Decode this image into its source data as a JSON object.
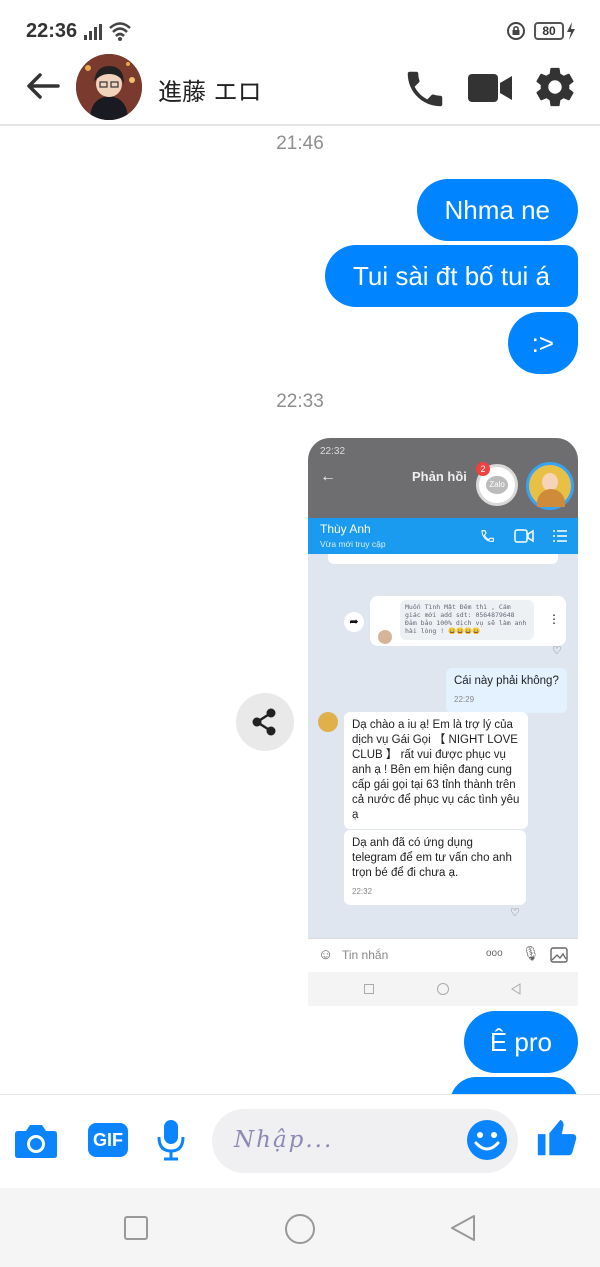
{
  "status_bar": {
    "time": "22:36",
    "battery": "80"
  },
  "header": {
    "contact_name": "進藤 エロ"
  },
  "messages": {
    "stamp1": "21:46",
    "bubble1": "Nhma ne",
    "bubble2": "Tui sài đt bố tui á",
    "bubble3": ":>",
    "stamp2": "22:33",
    "bubble4": "Ê pro"
  },
  "shared_screenshot": {
    "status_time": "22:32",
    "title": "Phản hồi",
    "zalo_badge": "2",
    "zalo_label": "Zalo",
    "contact": "Thùy Anh",
    "contact_status": "Vừa mới truy cập",
    "forward_text": "Muốn Tình Mặt Đêm thì , Cám giác mới add sdt: 0564879648 Đảm bảo 100% dịch vụ sẽ làm anh hài lòng ! 😀😀😀😀",
    "question": "Cái này phải không?",
    "question_time": "22:29",
    "reply1": "Dạ chào a iu ạ! Em là trợ lý của dịch vụ Gái Gọi 【 NIGHT LOVE CLUB 】 rất vui được phục vụ anh ạ ! Bên em hiện đang cung cấp gái gọi tại 63 tỉnh thành trên cả nước để phục vụ các tình yêu ạ",
    "reply2": "Dạ anh đã có ứng dụng telegram để em tư vấn cho anh trọn bé để đi chưa ạ.",
    "reply2_time": "22:32",
    "input_placeholder": "Tin nhắn",
    "dots": "ooo"
  },
  "composer": {
    "gif_label": "GIF",
    "placeholder": "Nhập..."
  },
  "colors": {
    "accent": "#0084ff"
  }
}
